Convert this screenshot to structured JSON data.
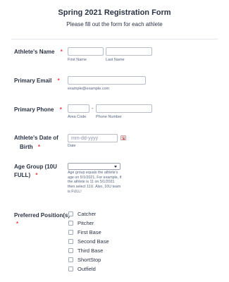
{
  "form": {
    "title": "Spring 2021 Registration Form",
    "subtitle": "Please fill out the form for each athlete"
  },
  "fields": {
    "athlete_name": {
      "label": "Athlete's Name",
      "required_mark": "*",
      "first_sublabel": "First Name",
      "last_sublabel": "Last Name",
      "first_value": "",
      "last_value": ""
    },
    "primary_email": {
      "label": "Primary Email",
      "required_mark": "*",
      "sublabel": "example@example.com",
      "value": ""
    },
    "primary_phone": {
      "label": "Primary Phone",
      "required_mark": "*",
      "area_sublabel": "Area Code",
      "number_sublabel": "Phone Number",
      "separator": "-",
      "area_value": "",
      "number_value": ""
    },
    "dob": {
      "label_line1": "Athlete's Date of",
      "label_line2": "Birth",
      "required_mark": "*",
      "placeholder": "mm-dd-yyyy",
      "sublabel": "Date",
      "icon": "calendar-icon"
    },
    "age_group": {
      "label_line1": "Age Group (10U",
      "label_line2": "FULL)",
      "required_mark": "*",
      "selected": "",
      "help_text": "Age group equals the athlete's age on 5/1/2021. For example, if the athlete is 11 on 5/1/2021 then select 11U. Also, 10U team is FULL!"
    },
    "positions": {
      "label": "Preferred Position(s)",
      "required_mark": "*",
      "options": [
        "Catcher",
        "Pitcher",
        "First Base",
        "Second Base",
        "Third Base",
        "ShortStop",
        "Outfield"
      ]
    }
  },
  "colors": {
    "required": "#f23a3c",
    "text": "#2c3345",
    "border": "#b8bdc9"
  }
}
